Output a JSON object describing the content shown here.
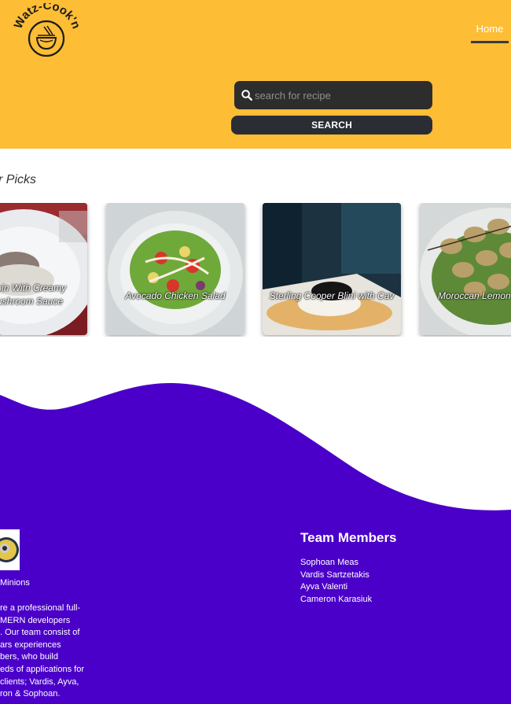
{
  "header": {
    "brand_text": "Watz-Cook'n",
    "nav": {
      "home_label": "Home"
    },
    "search": {
      "placeholder": "search for recipe",
      "button_label": "SEARCH"
    },
    "colors": {
      "background": "#fdbd35",
      "search_bg": "#2d2d2d",
      "button_bg": "#2b2d35"
    }
  },
  "picks": {
    "title": "r Picks",
    "cards": [
      {
        "caption_line1": "enderloin With Creamy",
        "caption_line2": "ted Mushroom Sauce"
      },
      {
        "caption": "Avocado Chicken Salad"
      },
      {
        "caption": "Sterling Cooper Blini with Cav"
      },
      {
        "caption": "Moroccan Lemon"
      }
    ]
  },
  "footer": {
    "colors": {
      "background": "#4b00c9"
    },
    "team_name": "Minions",
    "about_lines": [
      "re a professional full-",
      "MERN developers",
      ". Our team consist of",
      "ars experiences",
      "bers, who build",
      "eds of applications for",
      "clients; Vardis, Ayva,",
      "ron & Sophoan."
    ],
    "members_title": "Team Members",
    "members": [
      "Sophoan Meas",
      "Vardis Sartzetakis",
      "Ayva Valenti",
      "Cameron Karasiuk"
    ]
  }
}
